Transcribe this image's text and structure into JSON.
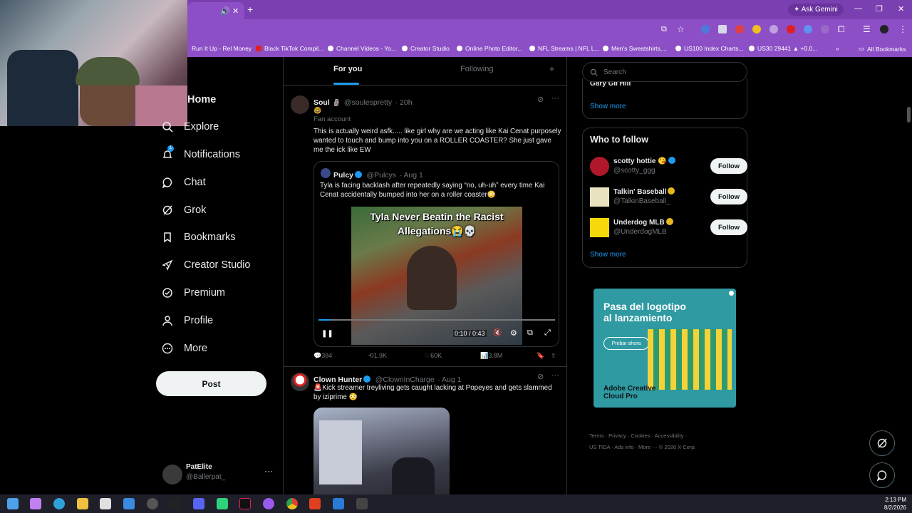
{
  "browser": {
    "ask_gemini": "Ask Gemini",
    "bookmarks": [
      "Run It Up - Rel Money",
      "Black TikTok Compil...",
      "Channel Videos - Yo...",
      "Creator Studio",
      "Online Photo Editor...",
      "NFL Streams | NFL L...",
      "Men's Sweatshirts,...",
      "US100 Index Charts...",
      "US30 29441 ▲ +0.0..."
    ],
    "all_bookmarks": "All Bookmarks"
  },
  "nav": {
    "items": [
      {
        "label": "Home",
        "icon": "home-icon"
      },
      {
        "label": "Explore",
        "icon": "search-icon"
      },
      {
        "label": "Notifications",
        "icon": "bell-icon",
        "badge": "1"
      },
      {
        "label": "Chat",
        "icon": "chat-icon"
      },
      {
        "label": "Grok",
        "icon": "grok-icon"
      },
      {
        "label": "Bookmarks",
        "icon": "bookmark-icon"
      },
      {
        "label": "Creator Studio",
        "icon": "rocket-icon"
      },
      {
        "label": "Premium",
        "icon": "premium-icon"
      },
      {
        "label": "Profile",
        "icon": "person-icon"
      },
      {
        "label": "More",
        "icon": "more-circle-icon"
      }
    ],
    "post_label": "Post",
    "account": {
      "name": "PatElite",
      "handle": "@Ballerpat_"
    }
  },
  "feed": {
    "tabs": {
      "for_you": "For you",
      "following": "Following",
      "plus": "+"
    },
    "tweet1": {
      "name": "Soul",
      "handle": "@soulespretty",
      "time": "· 20h",
      "fan_label": "Fan account",
      "text": "This is actually weird asfk..... like girl why are we acting like Kai Cenat purposely wanted to touch and bump into you on a ROLLER COASTER? She just gave me the ick like EW",
      "quote": {
        "name": "Pulcy",
        "handle": "@Pulcys",
        "time": "· Aug 1",
        "text": "Tyla is facing backlash after repeatedly saying “no, uh-uh” every time Kai Cenat accidentally bumped into her on a roller coaster😳",
        "video_title": "Tyla Never Beatin the Racist Allegations😭💀",
        "video_time": "0:10 / 0:43",
        "progress": 0.05
      },
      "replies": "384",
      "reposts": "1.9K",
      "likes": "60K",
      "views": "3.8M"
    },
    "tweet2": {
      "name": "Clown Hunter",
      "handle": "@ClownInCharge",
      "time": "· Aug 1",
      "text": "🚨Kick streamer treyliving gets caught lacking at Popeyes and gets slammed by iziprime 😳"
    }
  },
  "right": {
    "search_placeholder": "Search",
    "trend_partial": "Gary Gil Hill",
    "show_more": "Show more",
    "who_to_follow": "Who to follow",
    "follow_label": "Follow",
    "suggestions": [
      {
        "name": "scotty hottie 😘",
        "handle": "@scotty_ggg",
        "color": "#b0182a"
      },
      {
        "name": "Talkin' Baseball",
        "handle": "@TalkinBaseball_",
        "color": "#e8e2c0"
      },
      {
        "name": "Underdog MLB",
        "handle": "@UnderdogMLB",
        "color": "#f5d90a"
      }
    ],
    "ad": {
      "title": "Pasa del logotipo al lanzamiento",
      "cta": "Probar ahora",
      "brand": "Adobe Creative Cloud Pro"
    },
    "footer": {
      "line1": "Terms · Privacy · Cookies · Accessibility ·",
      "line2": "US TIDA · Ads info · More ··· © 2026 X Corp."
    }
  },
  "taskbar": {
    "time": "2:13 PM",
    "date": "8/2/2026"
  },
  "colors": {
    "accent": "#1d9bf0",
    "chrome": "#8c4fc6"
  }
}
